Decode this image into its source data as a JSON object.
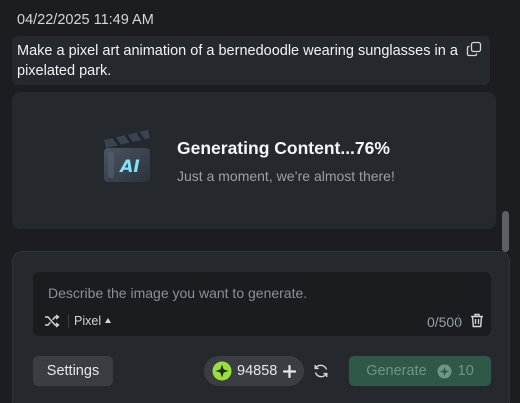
{
  "message": {
    "timestamp": "04/22/2025 11:49 AM",
    "prompt": "Make a pixel art animation of a bernedoodle wearing sunglasses in a pixelated park."
  },
  "generation": {
    "logo_text": "AI",
    "title": "Generating Content...76%",
    "progress_percent": 76,
    "subtitle": "Just a moment, we’re almost there!"
  },
  "composer": {
    "placeholder": "Describe the image you want to generate.",
    "style_value": "Pixel",
    "char_count": "0/500",
    "settings_label": "Settings",
    "credits": "94858",
    "generate_label": "Generate",
    "generate_cost": "10"
  },
  "colors": {
    "accent_green": "#2f5846",
    "coin": "#9be03a"
  },
  "icons": [
    "copy-icon",
    "ai-logo-icon",
    "shuffle-icon",
    "caret-up-icon",
    "trash-icon",
    "coin-icon",
    "plus-icon",
    "refresh-icon",
    "credit-cost-icon"
  ]
}
